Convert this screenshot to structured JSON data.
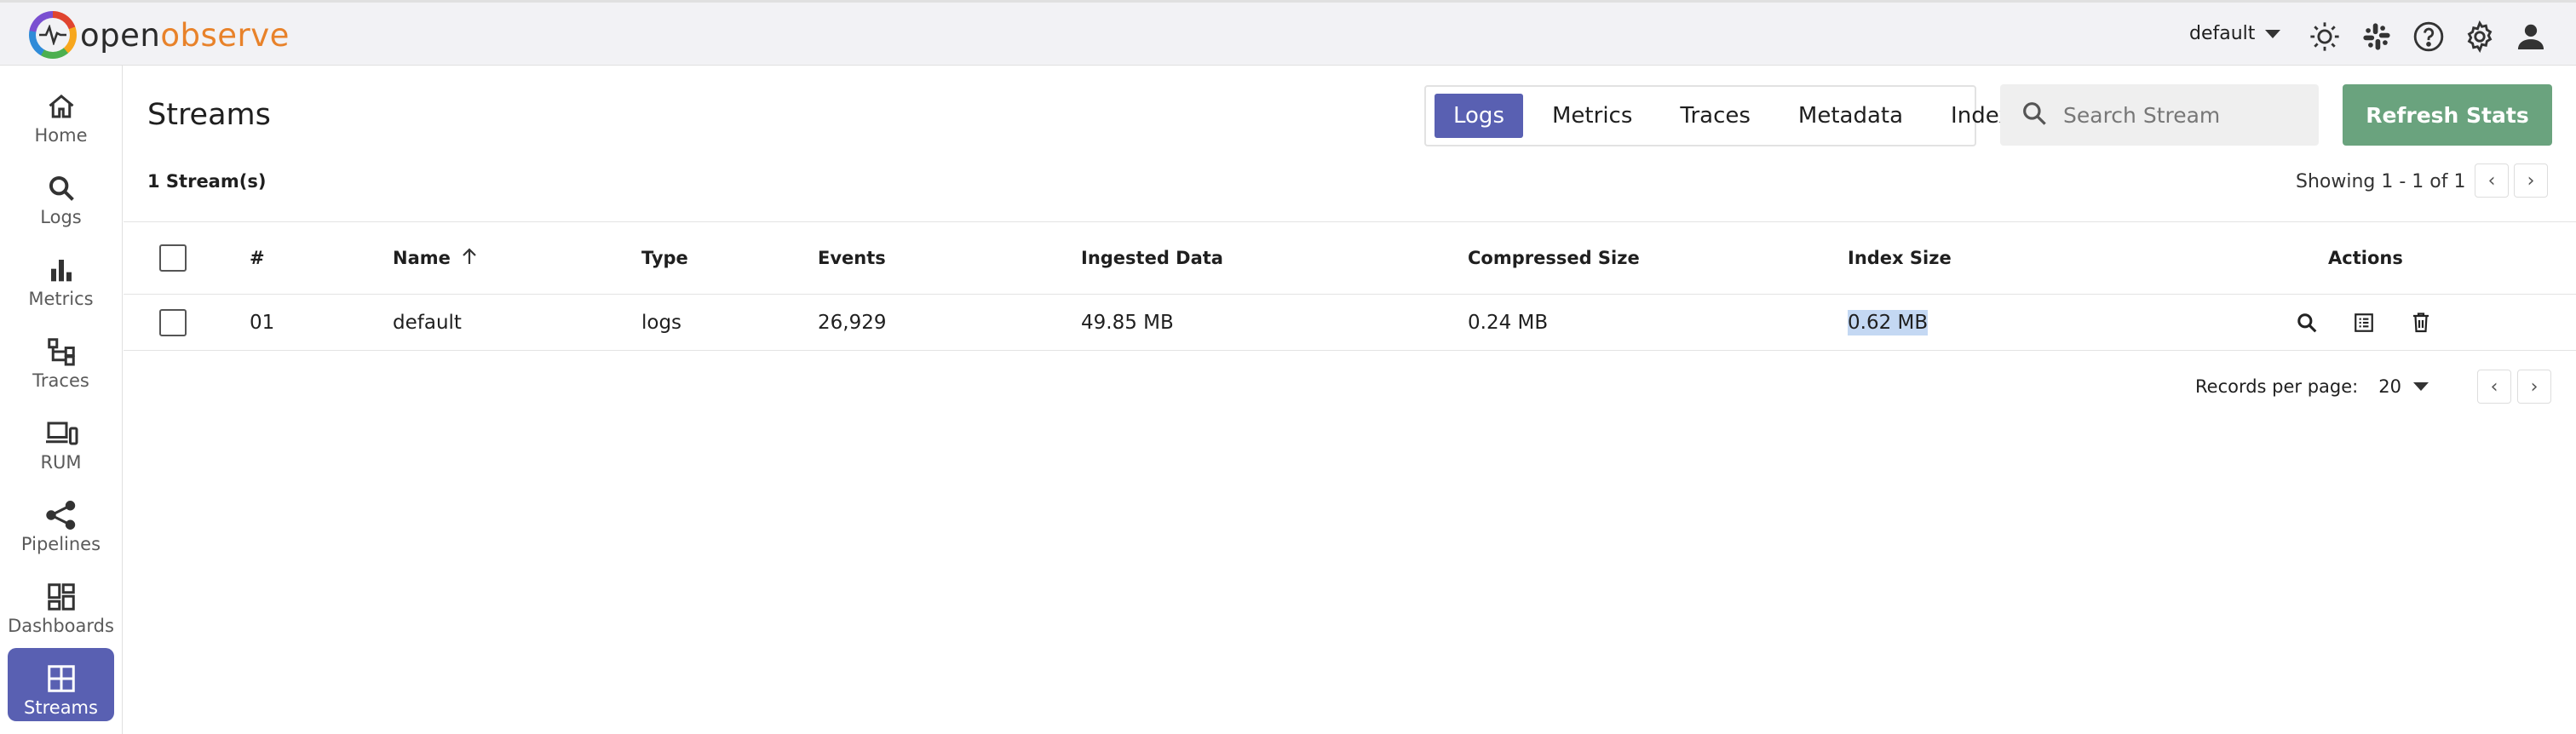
{
  "header": {
    "logo_open": "open",
    "logo_observe": "observe",
    "org": "default"
  },
  "sidebar": {
    "items": [
      {
        "label": "Home",
        "icon": "home-icon"
      },
      {
        "label": "Logs",
        "icon": "search-icon"
      },
      {
        "label": "Metrics",
        "icon": "bar-chart-icon"
      },
      {
        "label": "Traces",
        "icon": "tree-icon"
      },
      {
        "label": "RUM",
        "icon": "devices-icon"
      },
      {
        "label": "Pipelines",
        "icon": "share-icon"
      },
      {
        "label": "Dashboards",
        "icon": "dashboard-icon"
      },
      {
        "label": "Streams",
        "icon": "grid-icon",
        "active": true
      }
    ]
  },
  "main": {
    "title": "Streams",
    "tabs": [
      {
        "label": "Logs",
        "active": true
      },
      {
        "label": "Metrics"
      },
      {
        "label": "Traces"
      },
      {
        "label": "Metadata"
      },
      {
        "label": "Index"
      }
    ],
    "search_placeholder": "Search Stream",
    "refresh_label": "Refresh Stats",
    "stream_count": "1 Stream(s)",
    "showing": "Showing 1 - 1 of 1",
    "table": {
      "headers": [
        "#",
        "Name",
        "Type",
        "Events",
        "Ingested Data",
        "Compressed Size",
        "Index Size",
        "Actions"
      ],
      "rows": [
        {
          "num": "01",
          "name": "default",
          "type": "logs",
          "events": "26,929",
          "ingested": "49.85 MB",
          "compressed": "0.24 MB",
          "index_size": "0.62 MB"
        }
      ]
    },
    "records_per_page_label": "Records per page:",
    "records_per_page_value": "20"
  },
  "colors": {
    "accent": "#5960b2",
    "refresh_button": "#6aa37e",
    "selection_highlight": "#c4d8f3"
  }
}
